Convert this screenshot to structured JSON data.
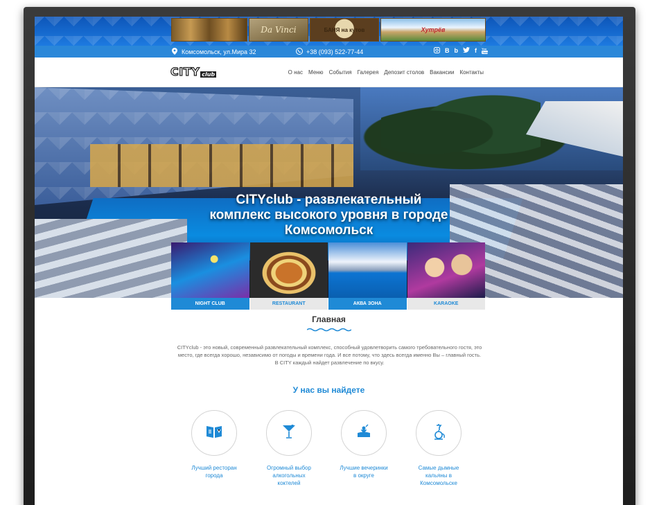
{
  "colors": {
    "accent": "#1f8ad6",
    "contact_bar": "#2a87d9",
    "frame": "#2b2b2b"
  },
  "ads": [
    {
      "label": ""
    },
    {
      "label": "Da Vinci"
    },
    {
      "label": "БАНЯ на кутов"
    },
    {
      "label": "Хутрёв"
    }
  ],
  "contact": {
    "address": "Комсомольск, ул.Мира 32",
    "address_icon": "map-pin-icon",
    "phone": "+38 (093) 522-77-44",
    "phone_icon": "phone-icon",
    "social": [
      "instagram-icon",
      "vk-icon",
      "b-icon",
      "twitter-icon",
      "facebook-icon",
      "youtube-icon"
    ]
  },
  "logo": {
    "city": "CITY",
    "club": "club"
  },
  "menu": [
    "О нас",
    "Меню",
    "События",
    "Галерея",
    "Депозит столов",
    "Вакансии",
    "Контакты"
  ],
  "hero": {
    "title_line1": "CITYclub - развлекательный",
    "title_line2": "комплекс высокого уровня в городе",
    "title_line3": "Комсомольск"
  },
  "tiles": [
    {
      "label": "NIGHT CLUB"
    },
    {
      "label": "RESTAURANT"
    },
    {
      "label": "АКВА ЗОНА"
    },
    {
      "label": "KARAOKE"
    }
  ],
  "main": {
    "title": "Главная",
    "intro": "CITYclub - это новый, современный развлекательный комплекс, способный удовлетворить самого требовательного гостя, это место, где всегда хорошо, независимо от погоды и времени года. И все потому, что здесь всегда именно Вы – главный гость. В CITY каждый найдет развлечение по вкусу.",
    "subtitle": "У нас вы найдете"
  },
  "features": [
    {
      "icon": "menu-book-icon",
      "line1": "Лучший ресторан",
      "line2": "города",
      "line3": ""
    },
    {
      "icon": "cocktail-glass-icon",
      "line1": "Огромный выбор",
      "line2": "алкогольных",
      "line3": "коктелей"
    },
    {
      "icon": "dj-party-icon",
      "line1": "Лучшие вечеринки",
      "line2": "в округе",
      "line3": ""
    },
    {
      "icon": "hookah-icon",
      "line1": "Самые дымные",
      "line2": "кальяны в",
      "line3": "Комсомольске"
    }
  ]
}
